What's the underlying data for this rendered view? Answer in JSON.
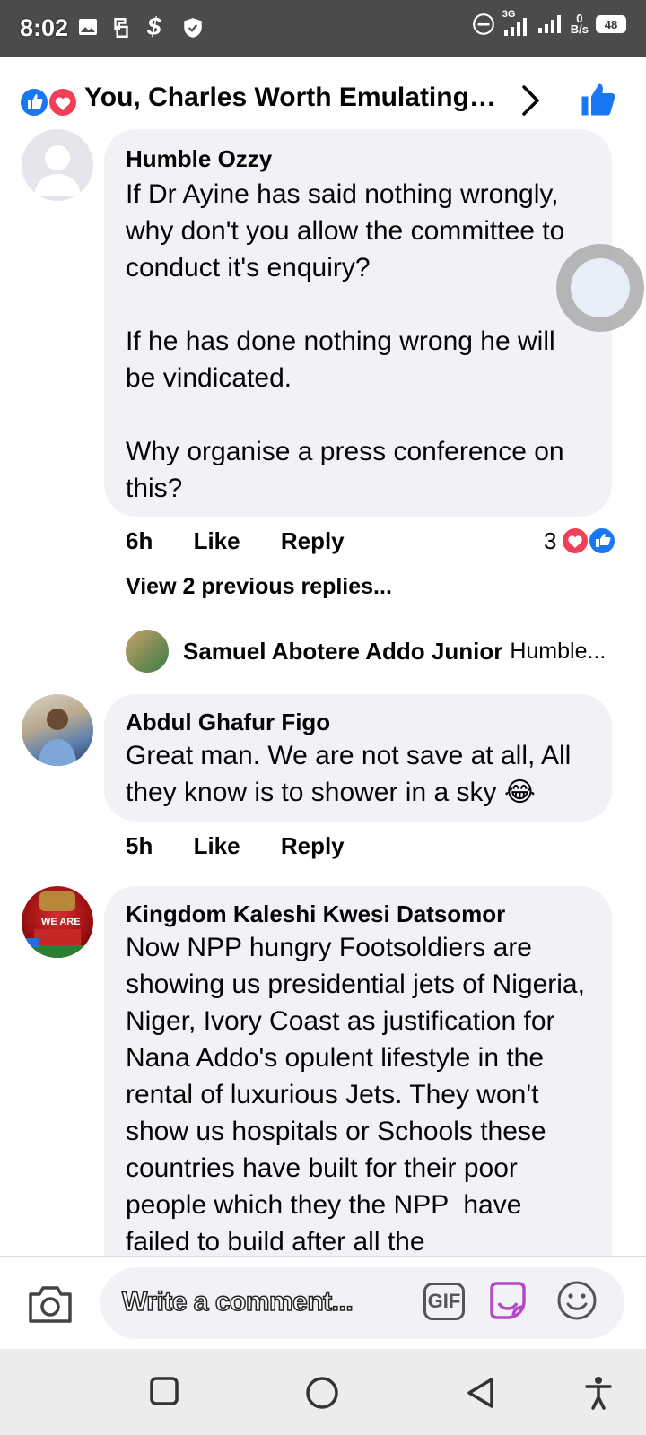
{
  "status_bar": {
    "time": "8:02",
    "network": "3G",
    "speed_value": "0",
    "speed_unit": "B/s",
    "battery": "48"
  },
  "header": {
    "title": "You, Charles Worth Emulating ...",
    "icons": [
      "like-reaction-icon",
      "love-reaction-icon",
      "chevron-right-icon",
      "thumbs-up-icon"
    ]
  },
  "comments": [
    {
      "author": "Humble Ozzy",
      "text": "If Dr Ayine has said nothing wrongly, why don't you allow the committee to conduct it's enquiry?\n\nIf he has done nothing wrong he will be vindicated.\n\nWhy organise a press conference on this?",
      "time": "6h",
      "like_label": "Like",
      "reply_label": "Reply",
      "reaction_count": "3"
    },
    {
      "author": "Abdul Ghafur Figo",
      "text": "Great man. We are not save at all, All they know is to shower in a sky 😂",
      "time": "5h",
      "like_label": "Like",
      "reply_label": "Reply"
    },
    {
      "author": "Kingdom Kaleshi Kwesi Datsomor",
      "text": "Now NPP hungry Footsoldiers are showing us presidential jets of Nigeria, Niger, Ivory Coast as justification for Nana Addo's opulent lifestyle in the rental of luxurious Jets. They won't show us hospitals or Schools these countries have built for their poor people which they the NPP  have failed to build after all the"
    }
  ],
  "replies": {
    "view_previous": "View 2 previous replies...",
    "latest_author": "Samuel Abotere Addo Junior",
    "latest_preview": "Humble..."
  },
  "composer": {
    "placeholder": "Write a comment...",
    "gif_label": "GIF"
  },
  "colors": {
    "facebook_blue": "#1877f2",
    "love_red": "#f33e58",
    "bubble_bg": "#f0f2f5",
    "statusbar_bg": "#4b4b4b"
  }
}
